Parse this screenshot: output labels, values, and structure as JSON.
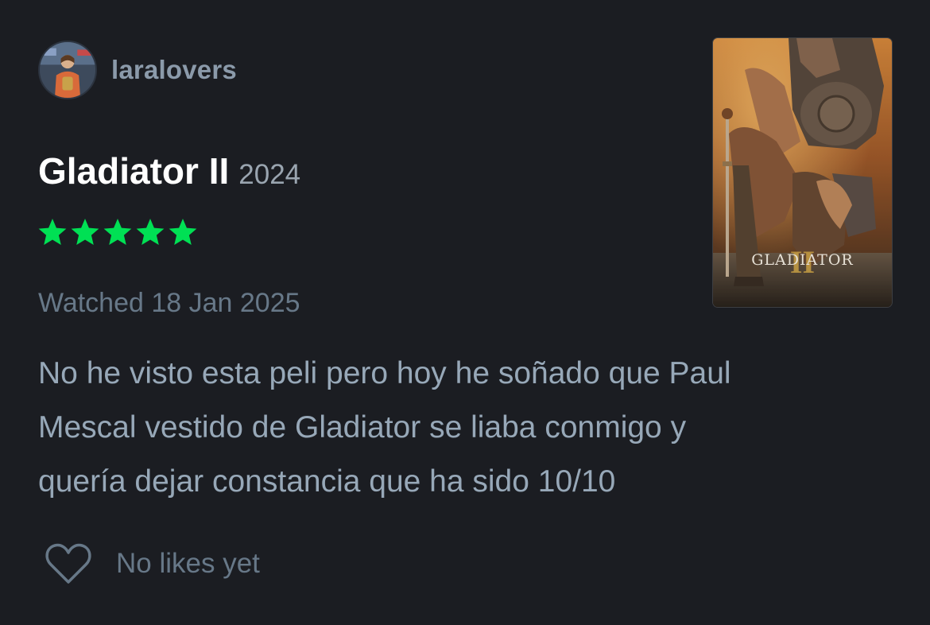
{
  "review": {
    "author": {
      "username": "laralovers",
      "avatar_icon": "user-avatar"
    },
    "film": {
      "title": "Gladiator II",
      "year": "2024",
      "poster_logo_text": "GLADIATOR",
      "poster_logo_numeral": "II"
    },
    "rating": {
      "stars": 5,
      "max_stars": 5,
      "color": "#00e054"
    },
    "watched_label": "Watched 18 Jan 2025",
    "body_lines": [
      "No he visto esta peli pero hoy he soñado que Paul",
      "Mescal vestido de Gladiator se liaba conmigo y",
      "quería dejar constancia que ha sido 10/10"
    ],
    "likes": {
      "icon": "heart-icon",
      "text": "No likes yet"
    }
  },
  "colors": {
    "background": "#1b1d22",
    "title": "#ffffff",
    "muted_text": "#677888",
    "body_text": "#97a8b8",
    "star_green": "#00e054"
  }
}
